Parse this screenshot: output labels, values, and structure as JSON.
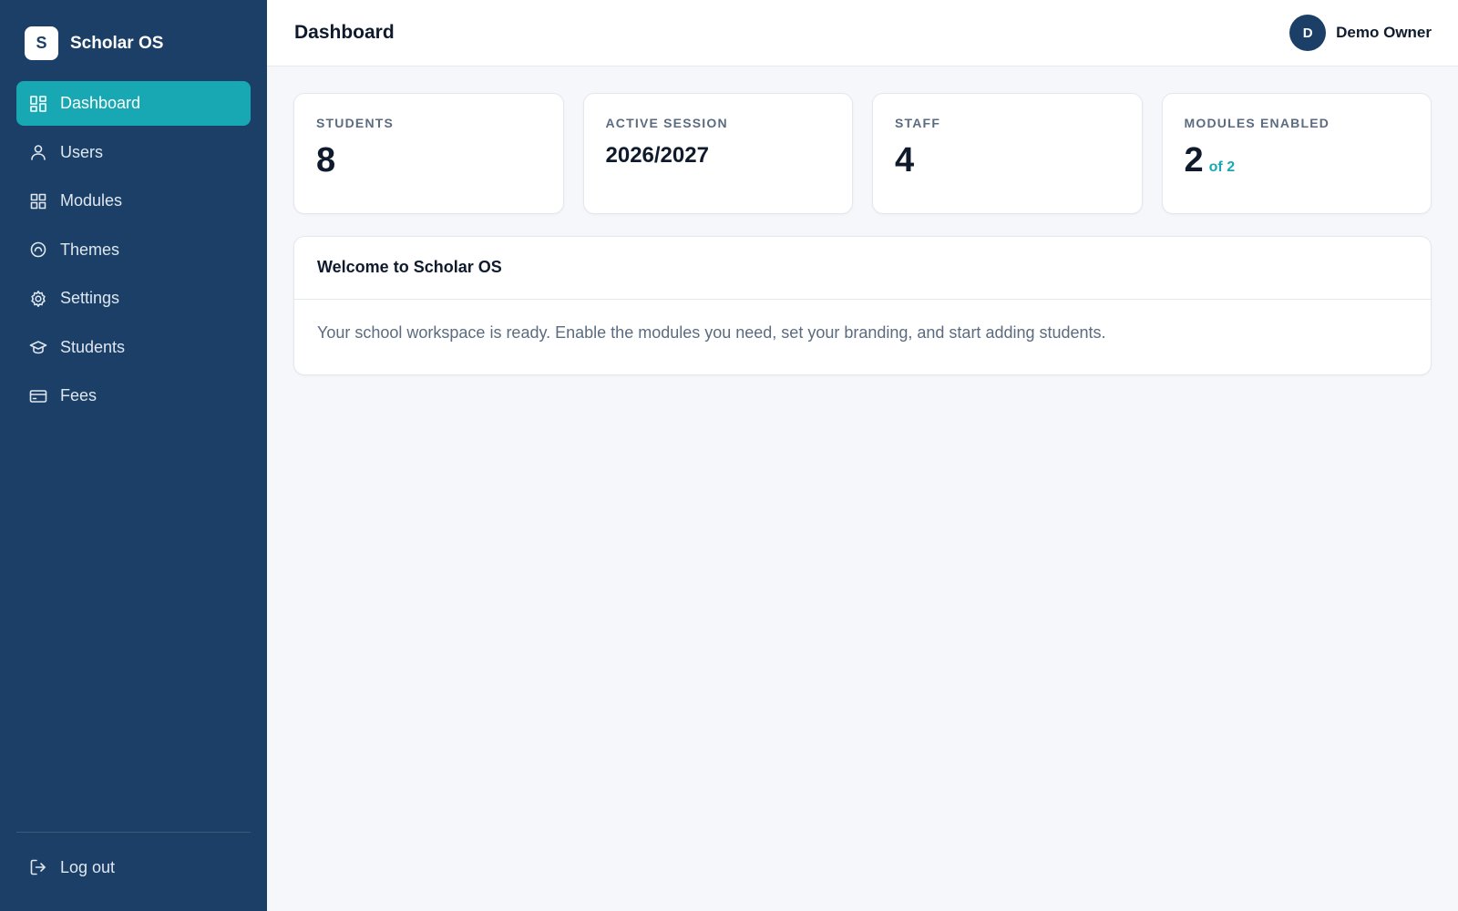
{
  "brand": {
    "logo_letter": "S",
    "name": "Scholar OS"
  },
  "sidebar": {
    "items": [
      {
        "label": "Dashboard",
        "icon": "dashboard-icon",
        "active": true
      },
      {
        "label": "Users",
        "icon": "user-icon",
        "active": false
      },
      {
        "label": "Modules",
        "icon": "modules-grid-icon",
        "active": false
      },
      {
        "label": "Themes",
        "icon": "themes-icon",
        "active": false
      },
      {
        "label": "Settings",
        "icon": "gear-icon",
        "active": false
      },
      {
        "label": "Students",
        "icon": "graduation-cap-icon",
        "active": false
      },
      {
        "label": "Fees",
        "icon": "credit-card-icon",
        "active": false
      }
    ],
    "logout_label": "Log out"
  },
  "header": {
    "title": "Dashboard",
    "user": {
      "initial": "D",
      "name": "Demo Owner"
    }
  },
  "stats": [
    {
      "label": "Students",
      "value": "8"
    },
    {
      "label": "Active Session",
      "value": "2026/2027"
    },
    {
      "label": "Staff",
      "value": "4"
    },
    {
      "label": "Modules Enabled",
      "value": "2",
      "sub": "of 2"
    }
  ],
  "welcome": {
    "title": "Welcome to Scholar OS",
    "body": "Your school workspace is ready. Enable the modules you need, set your branding, and start adding students."
  },
  "colors": {
    "sidebar_bg": "#1b3f66",
    "accent": "#17a8b4",
    "page_bg": "#f5f7fa"
  }
}
